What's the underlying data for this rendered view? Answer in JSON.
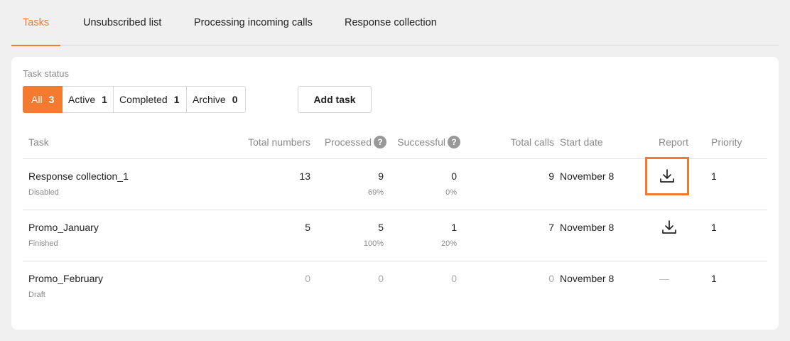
{
  "tabs": [
    {
      "label": "Tasks",
      "active": true
    },
    {
      "label": "Unsubscribed list",
      "active": false
    },
    {
      "label": "Processing incoming calls",
      "active": false
    },
    {
      "label": "Response collection",
      "active": false
    }
  ],
  "task_status": {
    "title": "Task status",
    "filters": [
      {
        "label": "All",
        "count": "3",
        "selected": true
      },
      {
        "label": "Active",
        "count": "1",
        "selected": false
      },
      {
        "label": "Completed",
        "count": "1",
        "selected": false
      },
      {
        "label": "Archive",
        "count": "0",
        "selected": false
      }
    ]
  },
  "add_task_label": "Add task",
  "table": {
    "headers": {
      "task": "Task",
      "total_numbers": "Total numbers",
      "processed": "Processed",
      "successful": "Successful",
      "total_calls": "Total calls",
      "start_date": "Start date",
      "report": "Report",
      "priority": "Priority"
    },
    "help_glyph": "?",
    "rows": [
      {
        "name": "Response collection_1",
        "status": "Disabled",
        "total_numbers": "13",
        "processed": "9",
        "processed_pct": "69%",
        "successful": "0",
        "successful_pct": "0%",
        "total_calls": "9",
        "start_date": "November 8",
        "report": "download",
        "priority": "1"
      },
      {
        "name": "Promo_January",
        "status": "Finished",
        "total_numbers": "5",
        "processed": "5",
        "processed_pct": "100%",
        "successful": "1",
        "successful_pct": "20%",
        "total_calls": "7",
        "start_date": "November 8",
        "report": "download",
        "priority": "1"
      },
      {
        "name": "Promo_February",
        "status": "Draft",
        "total_numbers": "0",
        "processed": "0",
        "processed_pct": "",
        "successful": "0",
        "successful_pct": "",
        "total_calls": "0",
        "start_date": "November 8",
        "report": "—",
        "priority": "1"
      }
    ]
  },
  "colors": {
    "accent": "#f47a30",
    "muted": "#8a8a8a"
  },
  "icons": {
    "report": "download-icon",
    "help": "question-circle-icon"
  }
}
